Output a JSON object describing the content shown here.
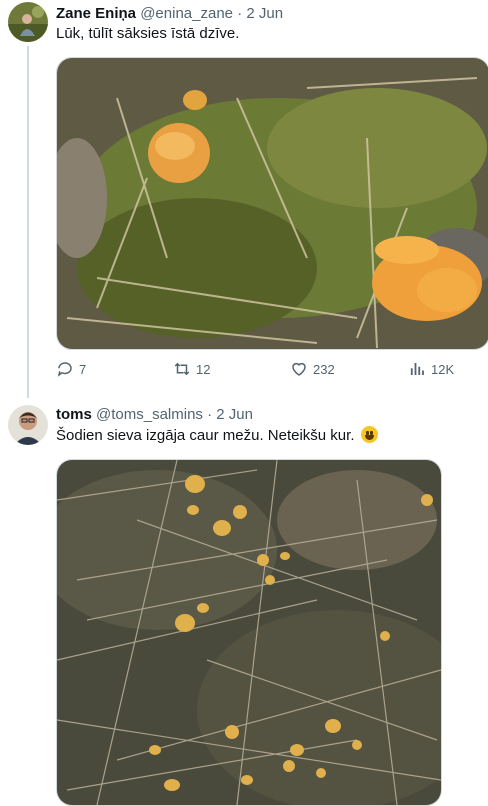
{
  "tweets": [
    {
      "author_name": "Zane Eniņa",
      "handle": "@enina_zane",
      "sep": "·",
      "date": "2 Jun",
      "text": "Lūk, tūlīt sāksies īstā dzīve.",
      "media": "photo of chanterelle mushrooms on mossy forest floor",
      "stats": {
        "replies": "7",
        "reposts": "12",
        "likes": "232",
        "views": "12K"
      }
    },
    {
      "author_name": "toms",
      "handle": "@toms_salmins",
      "sep": "·",
      "date": "2 Jun",
      "text": "Šodien sieva izgāja caur mežu. Neteikšu kur.",
      "emoji": "grinning-face",
      "media": "photo of many small chanterelles among pine needles"
    }
  ],
  "colors": {
    "text": "#0f1419",
    "muted": "#536471",
    "border": "#cfd9de"
  }
}
